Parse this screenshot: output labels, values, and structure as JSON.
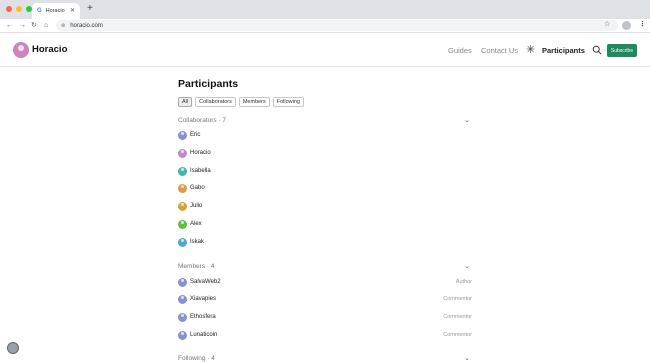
{
  "browser": {
    "tab_title": "Horacio",
    "tab_icon": "G",
    "url": "horacio.com",
    "colors": {
      "close": "#ff5f57",
      "minimize": "#febc2e",
      "maximize": "#28c840"
    }
  },
  "header": {
    "brand": "Horacio",
    "nav": {
      "guides": "Guides",
      "contact": "Contact Us",
      "participants": "Participants"
    },
    "subscribe": "Subscribe",
    "accent": "#1f8a5e"
  },
  "page": {
    "title": "Participants",
    "filters": [
      "All",
      "Collaborators",
      "Members",
      "Following"
    ]
  },
  "sections": {
    "collaborators": {
      "label": "Collaborators · 7",
      "people": [
        {
          "name": "Eric",
          "color": "#8b8fd4"
        },
        {
          "name": "Horacio",
          "color": "#c987c2"
        },
        {
          "name": "Isabella",
          "color": "#3fb8a8"
        },
        {
          "name": "Gabo",
          "color": "#e0994a"
        },
        {
          "name": "Julio",
          "color": "#d6a43a"
        },
        {
          "name": "Alex",
          "color": "#5bbf4a"
        },
        {
          "name": "Iskak",
          "color": "#4aa8d6"
        }
      ]
    },
    "members": {
      "label": "Members · 4",
      "people": [
        {
          "name": "SalvaWeb2",
          "role": "Author",
          "color": "#8b8fd4"
        },
        {
          "name": "Xiavapies",
          "role": "Commentor",
          "color": "#8b8fd4"
        },
        {
          "name": "Ethosfera",
          "role": "Commentor",
          "color": "#8b8fd4"
        },
        {
          "name": "Lunaticoin",
          "role": "Commentor",
          "color": "#8b8fd4"
        }
      ]
    },
    "following": {
      "label": "Following · 4"
    }
  }
}
